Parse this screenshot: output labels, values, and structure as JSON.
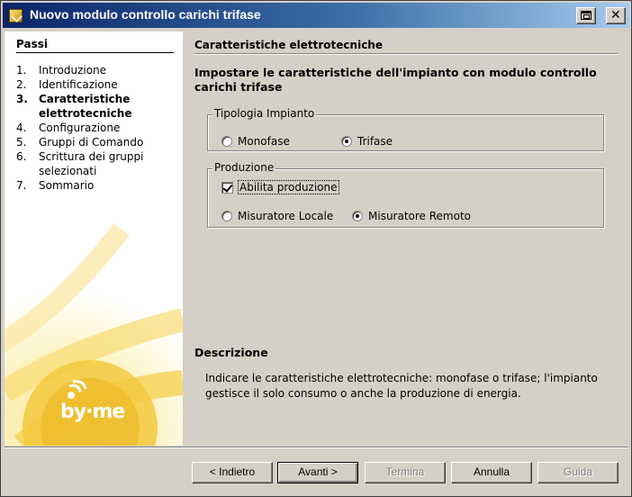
{
  "window": {
    "title": "Nuovo modulo controllo carichi trifase"
  },
  "sidebar": {
    "header": "Passi",
    "steps": [
      {
        "num": "1.",
        "label": "Introduzione"
      },
      {
        "num": "2.",
        "label": "Identificazione"
      },
      {
        "num": "3.",
        "label": "Caratteristiche elettrotecniche"
      },
      {
        "num": "4.",
        "label": "Configurazione"
      },
      {
        "num": "5.",
        "label": "Gruppi di Comando"
      },
      {
        "num": "6.",
        "label": "Scrittura dei gruppi selezionati"
      },
      {
        "num": "7.",
        "label": "Sommario"
      }
    ],
    "active_step": 3,
    "logo_text": "by·me"
  },
  "main": {
    "section_title": "Caratteristiche elettrotecniche",
    "instruction": "Impostare le caratteristiche dell'impianto con modulo controllo carichi trifase",
    "tipologia": {
      "legend": "Tipologia Impianto",
      "options": [
        "Monofase",
        "Trifase"
      ],
      "selected": "Trifase"
    },
    "produzione": {
      "legend": "Produzione",
      "enable_label": "Abilita produzione",
      "enable_checked": true,
      "options": [
        "Misuratore Locale",
        "Misuratore Remoto"
      ],
      "selected": "Misuratore Remoto"
    },
    "description": {
      "title": "Descrizione",
      "text": "Indicare le caratteristiche elettrotecniche: monofase o trifase; l'impianto gestisce il solo consumo o anche la produzione di energia."
    }
  },
  "buttons": {
    "back": "< Indietro",
    "next": "Avanti >",
    "finish": "Termina",
    "cancel": "Annulla",
    "help": "Guida"
  }
}
